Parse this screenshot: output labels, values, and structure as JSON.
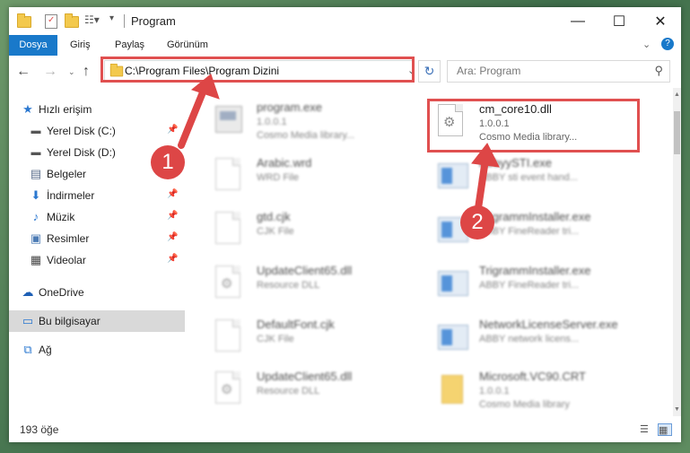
{
  "window": {
    "title": "Program"
  },
  "ribbon": {
    "tabs": [
      "Dosya",
      "Giriş",
      "Paylaş",
      "Görünüm"
    ]
  },
  "address": {
    "path": "C:\\Program Files\\Program Dizini"
  },
  "search": {
    "placeholder": "Ara: Program"
  },
  "sidebar": {
    "quick_access": "Hızlı erişim",
    "items": [
      {
        "label": "Yerel Disk (C:)",
        "pinned": true
      },
      {
        "label": "Yerel Disk (D:)",
        "pinned": false
      },
      {
        "label": "Belgeler",
        "pinned": true
      },
      {
        "label": "İndirmeler",
        "pinned": true
      },
      {
        "label": "Müzik",
        "pinned": true
      },
      {
        "label": "Resimler",
        "pinned": true
      },
      {
        "label": "Videolar",
        "pinned": true
      }
    ],
    "onedrive": "OneDrive",
    "this_pc": "Bu bilgisayar",
    "network": "Ağ"
  },
  "files": [
    {
      "name": "program.exe",
      "line1": "1.0.0.1",
      "line2": "Cosmo Media library...",
      "icon": "exe-icon",
      "blurred": true
    },
    {
      "name": "cm_core10.dll",
      "line1": "1.0.0.1",
      "line2": "Cosmo Media library...",
      "icon": "dll-gear-icon",
      "blurred": false
    },
    {
      "name": "Arabic.wrd",
      "line1": "WRD File",
      "line2": "",
      "icon": "document-icon",
      "blurred": true
    },
    {
      "name": "AbbyySTI.exe",
      "line1": "ABBY sti event hand...",
      "line2": "",
      "icon": "window-icon",
      "blurred": true
    },
    {
      "name": "gtd.cjk",
      "line1": "CJK File",
      "line2": "",
      "icon": "document-icon",
      "blurred": true
    },
    {
      "name": "TrigrammInstaller.exe",
      "line1": "ABBY FineReader tri...",
      "line2": "",
      "icon": "window-icon",
      "blurred": true
    },
    {
      "name": "UpdateClient65.dll",
      "line1": "Resource DLL",
      "line2": "",
      "icon": "dll-gear-icon",
      "blurred": true
    },
    {
      "name": "TrigrammInstaller.exe",
      "line1": "ABBY FineReader tri...",
      "line2": "",
      "icon": "window-icon",
      "blurred": true
    },
    {
      "name": "DefaultFont.cjk",
      "line1": "CJK File",
      "line2": "",
      "icon": "document-icon",
      "blurred": true
    },
    {
      "name": "NetworkLicenseServer.exe",
      "line1": "ABBY network licens...",
      "line2": "",
      "icon": "window-icon",
      "blurred": true
    },
    {
      "name": "UpdateClient65.dll",
      "line1": "Resource DLL",
      "line2": "",
      "icon": "dll-gear-icon",
      "blurred": true
    },
    {
      "name": "Microsoft.VC90.CRT",
      "line1": "1.0.0.1",
      "line2": "Cosmo Media library",
      "icon": "folder-icon",
      "blurred": true
    }
  ],
  "status": {
    "count": "193 öğe"
  },
  "annotations": {
    "step1": "1",
    "step2": "2",
    "color": "#dd4646"
  }
}
